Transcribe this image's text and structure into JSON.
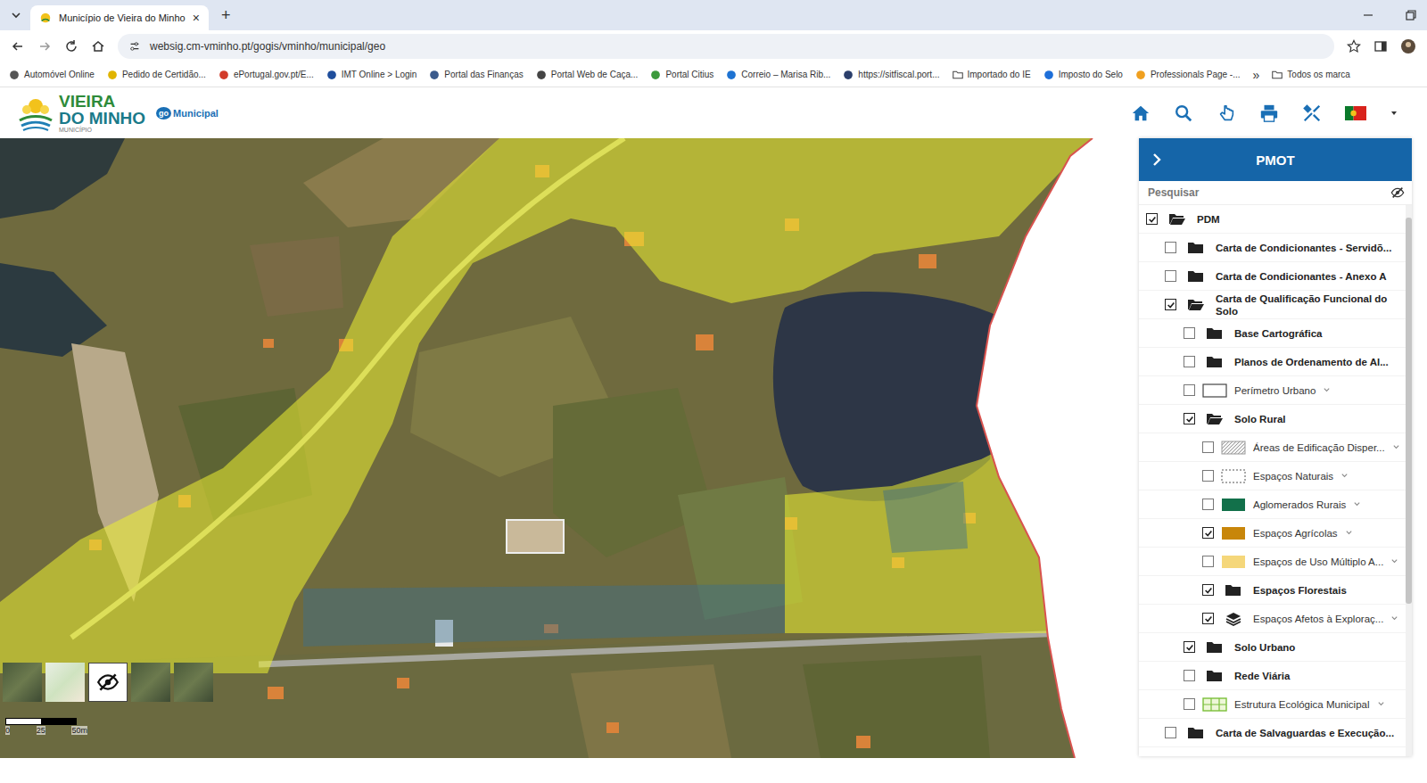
{
  "browser": {
    "tab": {
      "title": "Município de Vieira do Minho",
      "close": "×",
      "selected": true
    },
    "new_tab": "+",
    "address": "websig.cm-vminho.pt/gogis/vminho/municipal/geo",
    "bookmarks": [
      {
        "label": "Automóvel Online",
        "kind": "site",
        "color": "#555555"
      },
      {
        "label": "Pedido de Certidão...",
        "kind": "site",
        "color": "#e0b400"
      },
      {
        "label": "ePortugal.gov.pt/E...",
        "kind": "site",
        "color": "#d23c2a"
      },
      {
        "label": "IMT Online > Login",
        "kind": "site",
        "color": "#1f4e9c"
      },
      {
        "label": "Portal das Finanças",
        "kind": "site",
        "color": "#3a5a8c"
      },
      {
        "label": "Portal Web de Caça...",
        "kind": "site",
        "color": "#444444"
      },
      {
        "label": "Portal Citius",
        "kind": "site",
        "color": "#3c9a3c"
      },
      {
        "label": "Correio – Marisa Rib...",
        "kind": "site",
        "color": "#1e73d2"
      },
      {
        "label": "https://sitfiscal.port...",
        "kind": "site",
        "color": "#2b3f6b"
      },
      {
        "label": "Importado do IE",
        "kind": "folder",
        "color": "#444444"
      },
      {
        "label": "Imposto do Selo",
        "kind": "site",
        "color": "#1e6fd9"
      },
      {
        "label": "Professionals Page -...",
        "kind": "site",
        "color": "#f0a020"
      }
    ],
    "bookmarks_more": "»",
    "all_bookmarks": "Todos os marca"
  },
  "app": {
    "logo": {
      "line1": "VIEIRA",
      "line2": "DO MINHO",
      "line3": "MUNICÍPIO",
      "badge": "go",
      "badge_label": "Municipal"
    }
  },
  "map": {
    "scale": [
      "0",
      "25",
      "50m"
    ],
    "basemaps": [
      {
        "kind": "satellite"
      },
      {
        "kind": "streets"
      },
      {
        "kind": "none"
      },
      {
        "kind": "satellite"
      },
      {
        "kind": "satellite"
      }
    ]
  },
  "panel": {
    "title": "PMOT",
    "search": {
      "placeholder": "Pesquisar"
    },
    "tree": [
      {
        "label": "PDM",
        "level": 0,
        "kind": "folder",
        "checked": true,
        "expanded": true,
        "dropdown": false
      },
      {
        "label": "Carta de Condicionantes - Servidõ...",
        "level": 1,
        "kind": "folder",
        "checked": false,
        "expanded": false,
        "dropdown": false
      },
      {
        "label": "Carta de Condicionantes - Anexo A",
        "level": 1,
        "kind": "folder",
        "checked": false,
        "expanded": false,
        "dropdown": false
      },
      {
        "label": "Carta de Qualificação Funcional do Solo",
        "level": 1,
        "kind": "folder",
        "checked": true,
        "expanded": true,
        "dropdown": false
      },
      {
        "label": "Base Cartográfica",
        "level": 2,
        "kind": "folder",
        "checked": false,
        "expanded": false,
        "dropdown": false
      },
      {
        "label": "Planos de Ordenamento de Al...",
        "level": 2,
        "kind": "folder",
        "checked": false,
        "expanded": false,
        "dropdown": false
      },
      {
        "label": "Perímetro Urbano",
        "level": 2,
        "kind": "legend-box",
        "checked": false,
        "expanded": false,
        "dropdown": true
      },
      {
        "label": "Solo Rural",
        "level": 2,
        "kind": "folder",
        "checked": true,
        "expanded": true,
        "dropdown": false
      },
      {
        "label": "Áreas de Edificação Disper...",
        "level": 3,
        "kind": "legend-hatch",
        "checked": false,
        "expanded": false,
        "dropdown": true
      },
      {
        "label": "Espaços Naturais",
        "level": 3,
        "kind": "legend-dotted",
        "checked": false,
        "expanded": false,
        "dropdown": true
      },
      {
        "label": "Aglomerados Rurais",
        "level": 3,
        "kind": "legend-fill",
        "color": "#12704a",
        "checked": false,
        "expanded": false,
        "dropdown": true
      },
      {
        "label": "Espaços Agrícolas",
        "level": 3,
        "kind": "legend-fill",
        "color": "#c8860a",
        "checked": true,
        "expanded": false,
        "dropdown": true
      },
      {
        "label": "Espaços de Uso Múltiplo A...",
        "level": 3,
        "kind": "legend-fill",
        "color": "#f5d77a",
        "checked": false,
        "expanded": false,
        "dropdown": true
      },
      {
        "label": "Espaços Florestais",
        "level": 3,
        "kind": "folder",
        "checked": true,
        "expanded": false,
        "dropdown": false
      },
      {
        "label": "Espaços Afetos à Exploraç...",
        "level": 3,
        "kind": "layers",
        "checked": true,
        "expanded": false,
        "dropdown": true
      },
      {
        "label": "Solo Urbano",
        "level": 2,
        "kind": "folder",
        "checked": true,
        "expanded": false,
        "dropdown": false
      },
      {
        "label": "Rede Viária",
        "level": 2,
        "kind": "folder",
        "checked": false,
        "expanded": false,
        "dropdown": false
      },
      {
        "label": "Estrutura Ecológica Municipal",
        "level": 2,
        "kind": "legend-grid",
        "checked": false,
        "expanded": false,
        "dropdown": true
      },
      {
        "label": "Carta de Salvaguardas e Execução...",
        "level": 1,
        "kind": "folder",
        "checked": false,
        "expanded": false,
        "dropdown": false
      }
    ]
  }
}
